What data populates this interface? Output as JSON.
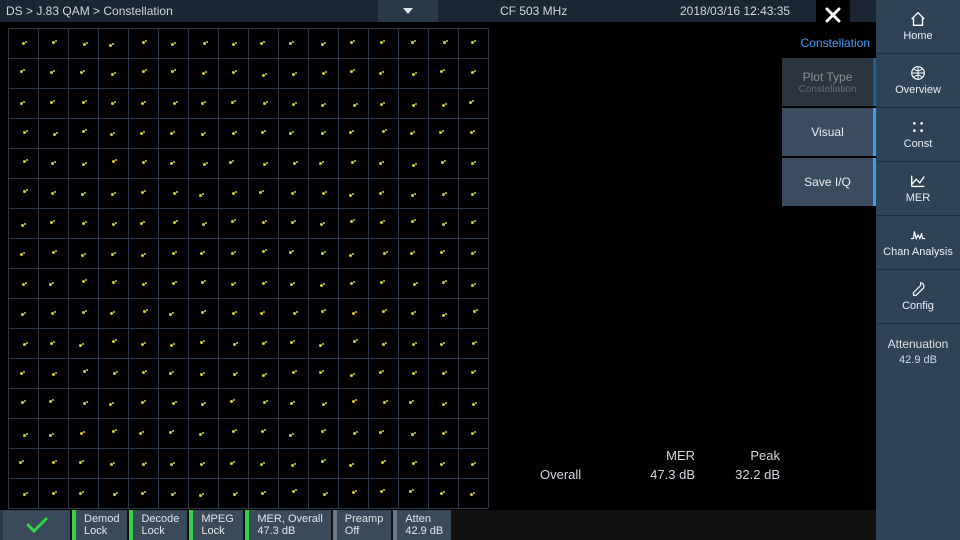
{
  "breadcrumb": "DS > J.83 QAM > Constellation",
  "center_freq": "CF 503 MHz",
  "datetime": "2018/03/16 12:43:35",
  "sidebar": [
    {
      "key": "home",
      "label": "Home"
    },
    {
      "key": "overview",
      "label": "Overview"
    },
    {
      "key": "const",
      "label": "Const"
    },
    {
      "key": "mer",
      "label": "MER"
    },
    {
      "key": "chan",
      "label": "Chan Analysis"
    },
    {
      "key": "config",
      "label": "Config"
    }
  ],
  "attenuation": {
    "label": "Attenuation",
    "value": "42.9 dB"
  },
  "submenu": {
    "title": "Constellation",
    "items": [
      {
        "label": "Plot Type",
        "sub": "Constellation",
        "disabled": true
      },
      {
        "label": "Visual",
        "sub": "",
        "disabled": false
      },
      {
        "label": "Save I/Q",
        "sub": "",
        "disabled": false
      }
    ]
  },
  "constellation": {
    "order": 16
  },
  "readouts": {
    "cols": [
      "MER",
      "Peak"
    ],
    "rows": [
      {
        "label": "Overall",
        "mer": "47.3 dB",
        "peak": "32.2 dB"
      }
    ]
  },
  "status": {
    "blocks": [
      {
        "l1": "Demod",
        "l2": "Lock",
        "ok": true
      },
      {
        "l1": "Decode",
        "l2": "Lock",
        "ok": true
      },
      {
        "l1": "MPEG",
        "l2": "Lock",
        "ok": true
      },
      {
        "l1": "MER, Overall",
        "l2": "47.3 dB",
        "ok": true
      },
      {
        "l1": "Preamp",
        "l2": "Off",
        "ok": false
      },
      {
        "l1": "Atten",
        "l2": "42.9 dB",
        "ok": false
      }
    ]
  }
}
